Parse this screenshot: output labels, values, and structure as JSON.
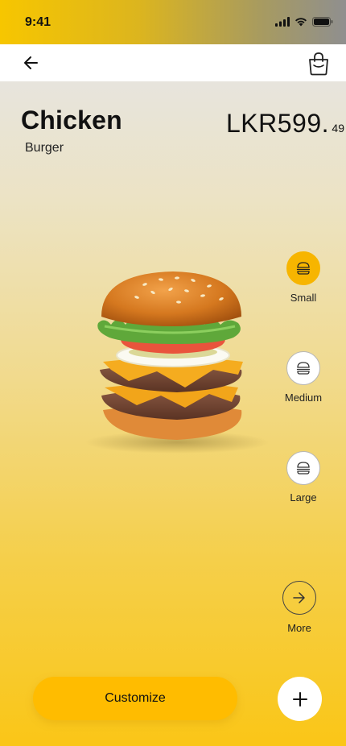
{
  "status": {
    "time": "9:41"
  },
  "product": {
    "name": "Chicken",
    "category": "Burger",
    "price_main": "LKR599.",
    "price_cents": "49"
  },
  "sizes": [
    {
      "label": "Small",
      "active": true
    },
    {
      "label": "Medium",
      "active": false
    },
    {
      "label": "Large",
      "active": false
    }
  ],
  "more_label": "More",
  "customize_label": "Customize",
  "icons": {
    "back": "arrow-left-icon",
    "bag": "shopping-bag-icon",
    "size": "burger-icon",
    "more": "arrow-right-icon",
    "add": "plus-icon"
  },
  "colors": {
    "accent": "#f7b500",
    "button": "#ffbc00"
  }
}
